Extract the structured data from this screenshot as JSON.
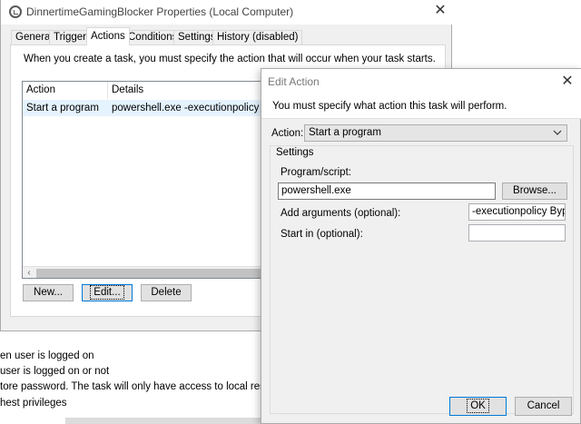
{
  "background": {
    "lines": [
      "en user is logged on",
      " user is logged on or not",
      "tore password.  The task will only have access to local resources",
      "hest privileges"
    ]
  },
  "props_window": {
    "title": "DinnertimeGamingBlocker Properties (Local Computer)",
    "close_glyph": "✕",
    "tabs": [
      "General",
      "Triggers",
      "Actions",
      "Conditions",
      "Settings",
      "History (disabled)"
    ],
    "active_tab": "Actions",
    "instruction": "When you create a task, you must specify the action that will occur when your task starts.",
    "table": {
      "columns": [
        "Action",
        "Details"
      ],
      "rows": [
        {
          "action": "Start a program",
          "details": "powershell.exe -executionpolicy Bypass -"
        }
      ],
      "scroll_left_glyph": "‹"
    },
    "buttons": {
      "new": "New...",
      "edit": "Edit...",
      "delete": "Delete"
    }
  },
  "edit_action": {
    "title": "Edit Action",
    "close_glyph": "✕",
    "instruction": "You must specify what action this task will perform.",
    "action_label": "Action:",
    "action_value": "Start a program",
    "settings_label": "Settings",
    "program_label": "Program/script:",
    "program_value": "powershell.exe",
    "browse_button": "Browse...",
    "arguments_label": "Add arguments (optional):",
    "arguments_value": "-executionpolicy Bypass",
    "start_in_label": "Start in (optional):",
    "start_in_value": "",
    "ok_button": "OK",
    "cancel_button": "Cancel"
  },
  "colors": {
    "accent": "#0078d7",
    "selection": "#e5f3ff",
    "dialog_bg": "#f0f0f0"
  }
}
